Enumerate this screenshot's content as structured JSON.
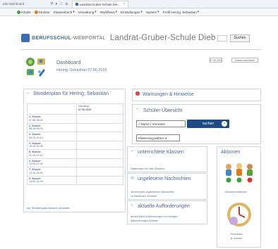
{
  "browser": {
    "url": "edu-dashboard",
    "nav_icons": "P ▾ ☆ ⊙",
    "tab_title": "Landrat-Gruber-Schule Die...",
    "tab_close": "×"
  },
  "menu": [
    {
      "label": "Inhalte",
      "color": "#3aa13a"
    },
    {
      "label": "Struktur",
      "color": "#e07b1a"
    },
    {
      "label": "Klassenbuch",
      "color": ""
    },
    {
      "label": "Verwaltung",
      "color": ""
    },
    {
      "label": "Workflows",
      "color": ""
    },
    {
      "label": "Einstellungen",
      "color": ""
    },
    {
      "label": "System",
      "color": ""
    },
    {
      "label": "Profil Hering, Sebastian",
      "color": ""
    }
  ],
  "header": {
    "brand_bold": "BERUFSSCHUL",
    "brand_rest": "-WEBPORTAL",
    "school": "Landrat-Gruber-Schule Dieb",
    "search_button": "Suchen"
  },
  "dashboard": {
    "title": "Dashboard",
    "subtitle": "Hering, Sebastian 07.06.2016",
    "date_field": "07.06.2016",
    "change_button": "Datum wechseln"
  },
  "stundenplan": {
    "title": "Stundenplan für Hering, Sebastian",
    "day_header_1": "Dienstag",
    "day_header_2": "07.06.2016",
    "rows": [
      {
        "name": "1. Stunde",
        "time": "07:55-08:40"
      },
      {
        "name": "2. Stunde",
        "time": "08:20-09:05"
      },
      {
        "name": "3. Stunde",
        "time": "09:25-10:10"
      },
      {
        "name": "4. Stunde",
        "time": "10:15-10:55"
      },
      {
        "name": "5. Stunde",
        "time": "11:15-12:00"
      },
      {
        "name": "6. Stunde",
        "time": "12:00-12:45"
      },
      {
        "name": "7. Stunde",
        "time": "13:15-14:00"
      },
      {
        "name": "8. Stunde",
        "time": "14:00-14:45"
      }
    ],
    "link": "zur Stundenplan-Ansicht wechseln"
  },
  "warnungen": {
    "title": "Warnungen & Hinweise"
  },
  "schueler": {
    "title": "Schüler-Übersicht",
    "input_placeholder": "Name / Vorname",
    "search_label": "suchen",
    "select_value": "Klassenzug wählen"
  },
  "klassen": {
    "title": "unterrichtete Klassen",
    "text": "Dashboard für alle Klassen"
  },
  "nachrichten": {
    "title": "ungelesene Nachrichten",
    "text1": "derzeit keine ungelesenen Nachrichten",
    "text2": "im Dashboard-Zentrale"
  },
  "aufforderungen": {
    "title": "aktuelle Aufforderungen",
    "text1": "derzeit keine Aufforderungen zu erledigen",
    "text2": "Aufforderungen-Zentrale"
  },
  "aktionen": {
    "title": "Aktionen",
    "item1": "Anwesenheitslisten",
    "item2_line1": "Fehlzeiten",
    "item2_line2": "je Schüler"
  }
}
